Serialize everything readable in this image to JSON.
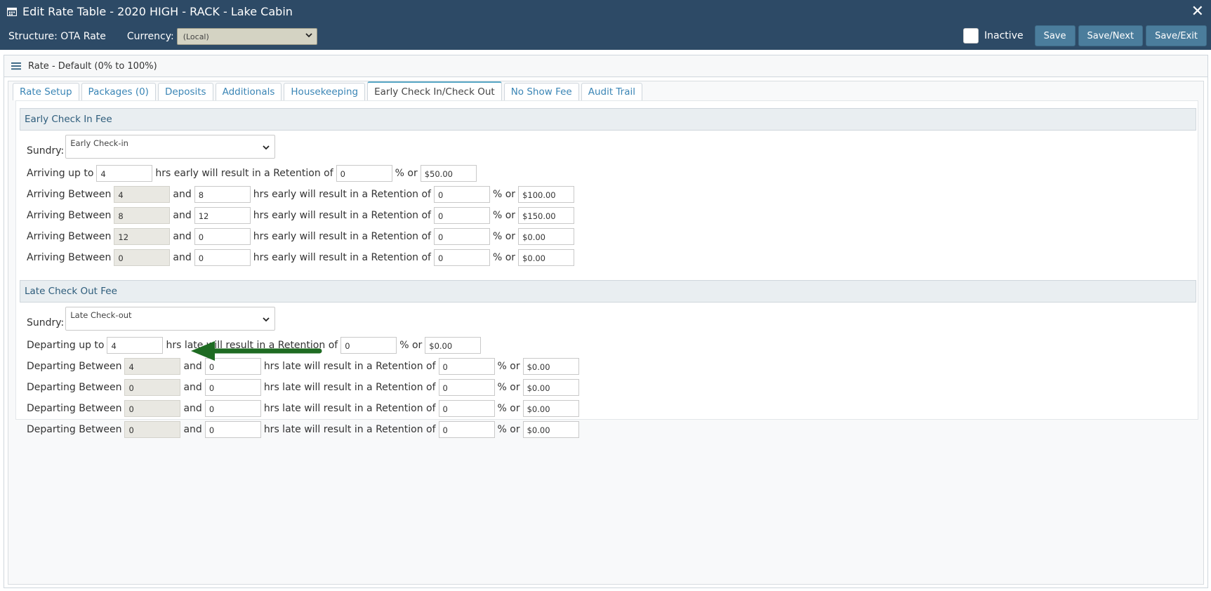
{
  "header": {
    "title": "Edit Rate Table - 2020 HIGH - RACK - Lake Cabin",
    "structure_label": "Structure: OTA Rate",
    "currency_label": "Currency:",
    "currency_value": "(Local)",
    "inactive_label": "Inactive",
    "inactive_checked": false,
    "buttons": {
      "save": "Save",
      "save_next": "Save/Next",
      "save_exit": "Save/Exit"
    },
    "close_glyph": "✕"
  },
  "panel": {
    "title": "Rate - Default (0% to 100%)"
  },
  "tabs": [
    {
      "label": "Rate Setup",
      "active": false
    },
    {
      "label": "Packages (0)",
      "active": false
    },
    {
      "label": "Deposits",
      "active": false
    },
    {
      "label": "Additionals",
      "active": false
    },
    {
      "label": "Housekeeping",
      "active": false
    },
    {
      "label": "Early Check In/Check Out",
      "active": true
    },
    {
      "label": "No Show Fee",
      "active": false
    },
    {
      "label": "Audit Trail",
      "active": false
    }
  ],
  "early": {
    "heading": "Early Check In Fee",
    "sundry_label": "Sundry:",
    "sundry_value": "Early Check-in",
    "first": {
      "prefix": "Arriving up to",
      "hours": "4",
      "mid": "hrs early will result in a Retention of",
      "pct": "0",
      "or": "% or",
      "amount": "$50.00"
    },
    "between_label": "Arriving Between",
    "and_label": "and",
    "mid_label": "hrs early will result in a Retention of",
    "or_label": "% or",
    "rows": [
      {
        "from": "4",
        "to": "8",
        "pct": "0",
        "amount": "$100.00"
      },
      {
        "from": "8",
        "to": "12",
        "pct": "0",
        "amount": "$150.00"
      },
      {
        "from": "12",
        "to": "0",
        "pct": "0",
        "amount": "$0.00"
      },
      {
        "from": "0",
        "to": "0",
        "pct": "0",
        "amount": "$0.00"
      }
    ]
  },
  "late": {
    "heading": "Late Check Out Fee",
    "sundry_label": "Sundry:",
    "sundry_value": "Late Check-out",
    "first": {
      "prefix": "Departing up to",
      "hours": "4",
      "mid": "hrs late will result in a Retention of",
      "pct": "0",
      "or": "% or",
      "amount": "$0.00"
    },
    "between_label": "Departing Between",
    "and_label": "and",
    "mid_label": "hrs late will result in a Retention of",
    "or_label": "% or",
    "rows": [
      {
        "from": "4",
        "to": "0",
        "pct": "0",
        "amount": "$0.00"
      },
      {
        "from": "0",
        "to": "0",
        "pct": "0",
        "amount": "$0.00"
      },
      {
        "from": "0",
        "to": "0",
        "pct": "0",
        "amount": "$0.00"
      },
      {
        "from": "0",
        "to": "0",
        "pct": "0",
        "amount": "$0.00"
      }
    ]
  },
  "colors": {
    "header_bg": "#2d4a66",
    "button_bg": "#4b7d9c",
    "tab_link": "#3a85b5",
    "arrow": "#1e6b22"
  }
}
